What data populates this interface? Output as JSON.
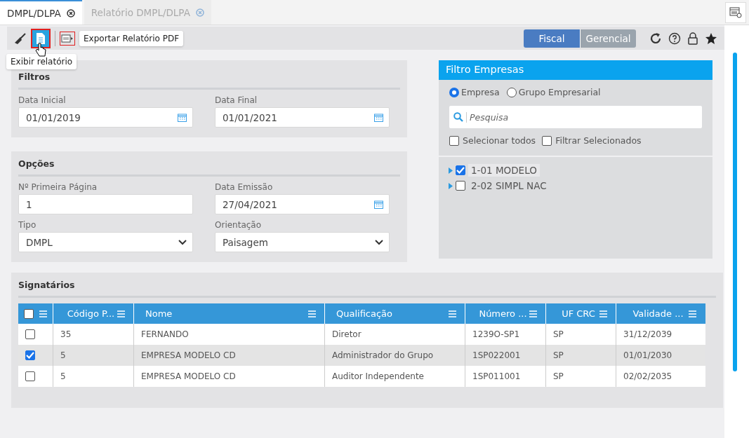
{
  "tabs": [
    {
      "label": "DMPL/DLPA",
      "selected": true
    },
    {
      "label": "Relatório DMPL/DLPA",
      "selected": false
    }
  ],
  "toolbar": {
    "tooltip_export": "Exportar Relatório PDF",
    "tooltip_show": "Exibir relatório",
    "modes": [
      {
        "label": "Fiscal",
        "selected": true
      },
      {
        "label": "Gerencial",
        "selected": false
      }
    ]
  },
  "filters": {
    "title": "Filtros",
    "fields": [
      {
        "label": "Data Inicial",
        "value": "01/01/2019",
        "kind": "date"
      },
      {
        "label": "Data Final",
        "value": "01/01/2021",
        "kind": "date"
      }
    ]
  },
  "options": {
    "title": "Opções",
    "fields": [
      {
        "label": "Nº Primeira Página",
        "value": "1",
        "kind": "text"
      },
      {
        "label": "Data Emissão",
        "value": "27/04/2021",
        "kind": "date"
      },
      {
        "label": "Tipo",
        "value": "DMPL",
        "kind": "select"
      },
      {
        "label": "Orientação",
        "value": "Paisagem",
        "kind": "select"
      }
    ]
  },
  "company_filter": {
    "title": "Filtro Empresas",
    "radios": [
      {
        "label": "Empresa",
        "selected": true
      },
      {
        "label": "Grupo Empresarial",
        "selected": false
      }
    ],
    "search": {
      "placeholder": "Pesquisa"
    },
    "checks": [
      {
        "label": "Selecionar todos",
        "checked": false
      },
      {
        "label": "Filtrar Selecionados",
        "checked": false
      }
    ],
    "tree": [
      {
        "label": "1-01 MODELO",
        "checked": true,
        "expanded": false
      },
      {
        "label": "2-02 SIMPL NAC",
        "checked": false,
        "expanded": false
      }
    ]
  },
  "signatories": {
    "title": "Signatários",
    "all_checked": false,
    "columns": [
      "Código P...",
      "Nome",
      "Qualificação",
      "Número ...",
      "UF CRC",
      "Validade ..."
    ],
    "rows": [
      {
        "checked": false,
        "cells": [
          "35",
          "FERNANDO",
          "Diretor",
          "1239O-SP1",
          "SP",
          "31/12/2039"
        ]
      },
      {
        "checked": true,
        "cells": [
          "5",
          "EMPRESA MODELO CD",
          "Administrador do Grupo",
          "1SP022001",
          "SP",
          "01/01/2030"
        ]
      },
      {
        "checked": false,
        "cells": [
          "5",
          "EMPRESA MODELO CD",
          "Auditor Independente",
          "1SP011001",
          "SP",
          "02/02/2035"
        ]
      }
    ]
  }
}
